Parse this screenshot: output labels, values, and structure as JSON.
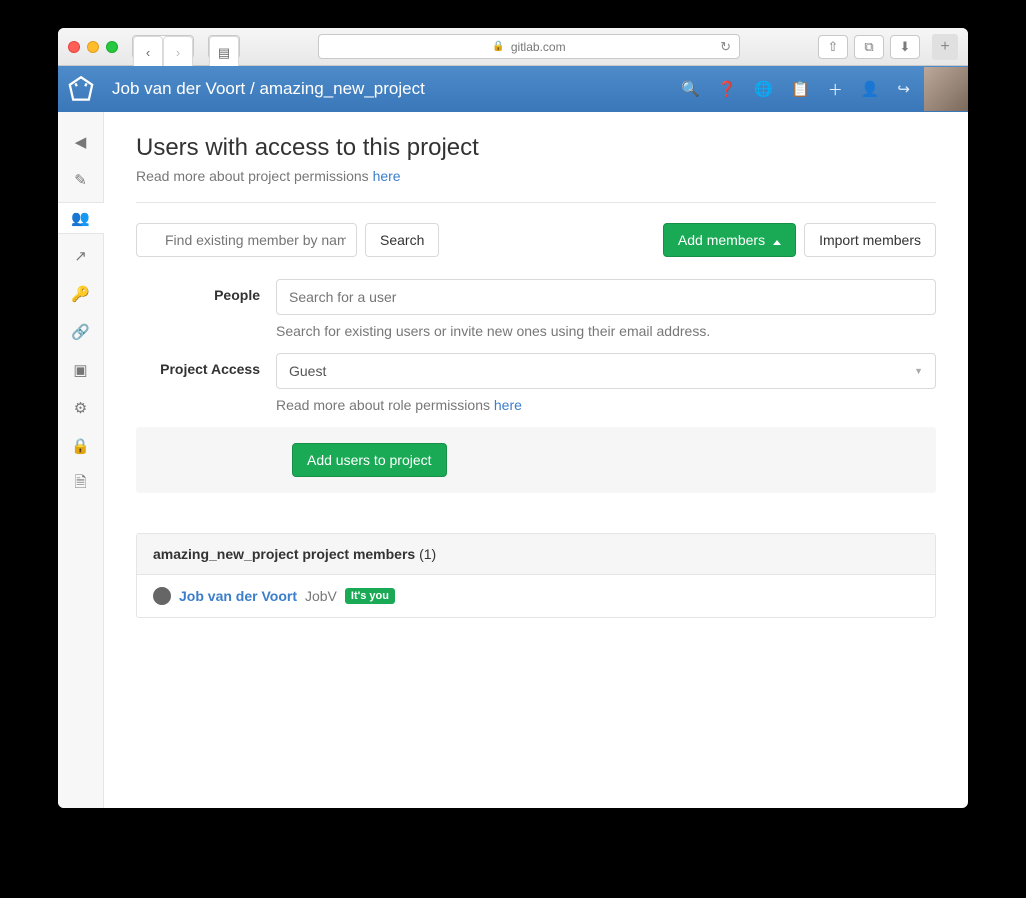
{
  "browser": {
    "domain": "gitlab.com"
  },
  "header": {
    "breadcrumb_owner": "Job van der Voort",
    "breadcrumb_sep": " / ",
    "breadcrumb_project": "amazing_new_project"
  },
  "page": {
    "title": "Users with access to this project",
    "subtext_prefix": "Read more about project permissions ",
    "subtext_link": "here"
  },
  "search": {
    "placeholder": "Find existing member by name",
    "button": "Search"
  },
  "buttons": {
    "add_members": "Add members",
    "import_members": "Import members",
    "add_users": "Add users to project"
  },
  "form": {
    "people_label": "People",
    "people_placeholder": "Search for a user",
    "people_help": "Search for existing users or invite new ones using their email address.",
    "access_label": "Project Access",
    "access_value": "Guest",
    "access_help_prefix": "Read more about role permissions ",
    "access_help_link": "here"
  },
  "members": {
    "header_prefix": "amazing_new_project project members ",
    "header_count": "(1)",
    "rows": [
      {
        "name": "Job van der Voort",
        "handle": "JobV",
        "you_badge": "It's you"
      }
    ]
  }
}
